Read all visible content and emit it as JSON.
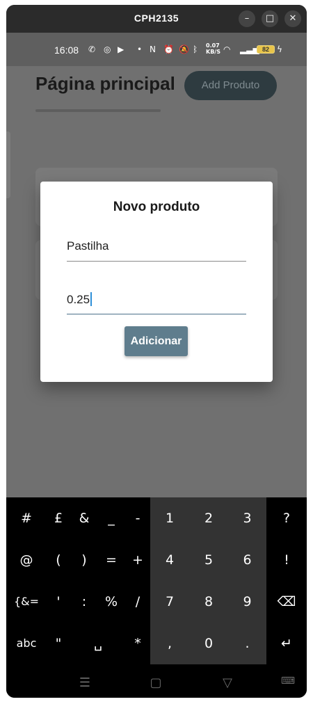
{
  "window": {
    "title": "CPH2135",
    "minimize_label": "–",
    "maximize_label": "□",
    "close_label": "✕"
  },
  "statusbar": {
    "time": "16:08",
    "icons": [
      "whatsapp-icon",
      "instagram-icon",
      "youtube-icon",
      "dot-icon",
      "nfc-icon",
      "alarm-icon",
      "mute-icon",
      "bluetooth-icon",
      "data-speed",
      "wifi-icon",
      "signal-icon",
      "battery-icon",
      "charging-icon"
    ],
    "data_speed": "0.07\nKB/S",
    "battery": "82"
  },
  "app": {
    "title": "Página principal",
    "add_button": "Add Produto"
  },
  "dialog": {
    "title": "Novo produto",
    "name_value": "Pastilha",
    "price_value": "0.25",
    "submit_label": "Adicionar"
  },
  "keyboard": {
    "rows": [
      [
        "#",
        "£",
        "&",
        "_",
        "-",
        "1",
        "2",
        "3",
        "?"
      ],
      [
        "@",
        "(",
        ")",
        "=",
        "+",
        "4",
        "5",
        "6",
        "!"
      ],
      [
        "{&=",
        "'",
        ":",
        "%",
        "/",
        "7",
        "8",
        "9",
        "⌫"
      ],
      [
        "abc",
        "\"",
        "␣",
        "*",
        ",",
        "0",
        ".",
        "↵"
      ]
    ]
  },
  "colors": {
    "accent": "#5f7d8d",
    "caret": "#2d8fd8",
    "scrim": "#707070"
  }
}
